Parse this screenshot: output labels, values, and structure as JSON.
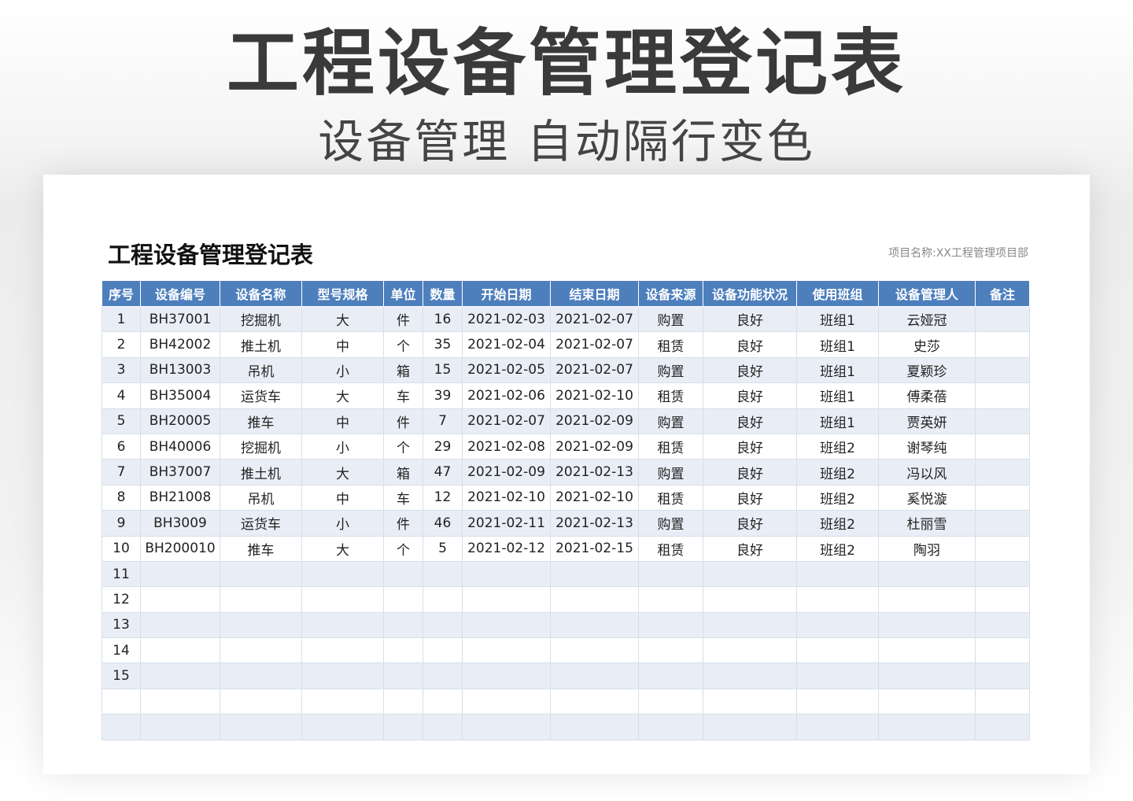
{
  "hero": {
    "title": "工程设备管理登记表",
    "subtitle": "设备管理 自动隔行变色"
  },
  "sheet": {
    "title": "工程设备管理登记表",
    "project_label": "项目名称:",
    "project_name": "XX工程管理项目部"
  },
  "table": {
    "headers": [
      "序号",
      "设备编号",
      "设备名称",
      "型号规格",
      "单位",
      "数量",
      "开始日期",
      "结束日期",
      "设备来源",
      "设备功能状况",
      "使用班组",
      "设备管理人",
      "备注"
    ],
    "rows": [
      [
        "1",
        "BH37001",
        "挖掘机",
        "大",
        "件",
        "16",
        "2021-02-03",
        "2021-02-07",
        "购置",
        "良好",
        "班组1",
        "云娅冠",
        ""
      ],
      [
        "2",
        "BH42002",
        "推土机",
        "中",
        "个",
        "35",
        "2021-02-04",
        "2021-02-07",
        "租赁",
        "良好",
        "班组1",
        "史莎",
        ""
      ],
      [
        "3",
        "BH13003",
        "吊机",
        "小",
        "箱",
        "15",
        "2021-02-05",
        "2021-02-07",
        "购置",
        "良好",
        "班组1",
        "夏颖珍",
        ""
      ],
      [
        "4",
        "BH35004",
        "运货车",
        "大",
        "车",
        "39",
        "2021-02-06",
        "2021-02-10",
        "租赁",
        "良好",
        "班组1",
        "傅柔蓓",
        ""
      ],
      [
        "5",
        "BH20005",
        "推车",
        "中",
        "件",
        "7",
        "2021-02-07",
        "2021-02-09",
        "购置",
        "良好",
        "班组1",
        "贾英妍",
        ""
      ],
      [
        "6",
        "BH40006",
        "挖掘机",
        "小",
        "个",
        "29",
        "2021-02-08",
        "2021-02-09",
        "租赁",
        "良好",
        "班组2",
        "谢琴纯",
        ""
      ],
      [
        "7",
        "BH37007",
        "推土机",
        "大",
        "箱",
        "47",
        "2021-02-09",
        "2021-02-13",
        "购置",
        "良好",
        "班组2",
        "冯以风",
        ""
      ],
      [
        "8",
        "BH21008",
        "吊机",
        "中",
        "车",
        "12",
        "2021-02-10",
        "2021-02-10",
        "租赁",
        "良好",
        "班组2",
        "奚悦漩",
        ""
      ],
      [
        "9",
        "BH3009",
        "运货车",
        "小",
        "件",
        "46",
        "2021-02-11",
        "2021-02-13",
        "购置",
        "良好",
        "班组2",
        "杜丽雪",
        ""
      ],
      [
        "10",
        "BH200010",
        "推车",
        "大",
        "个",
        "5",
        "2021-02-12",
        "2021-02-15",
        "租赁",
        "良好",
        "班组2",
        "陶羽",
        ""
      ],
      [
        "11",
        "",
        "",
        "",
        "",
        "",
        "",
        "",
        "",
        "",
        "",
        "",
        ""
      ],
      [
        "12",
        "",
        "",
        "",
        "",
        "",
        "",
        "",
        "",
        "",
        "",
        "",
        ""
      ],
      [
        "13",
        "",
        "",
        "",
        "",
        "",
        "",
        "",
        "",
        "",
        "",
        "",
        ""
      ],
      [
        "14",
        "",
        "",
        "",
        "",
        "",
        "",
        "",
        "",
        "",
        "",
        "",
        ""
      ],
      [
        "15",
        "",
        "",
        "",
        "",
        "",
        "",
        "",
        "",
        "",
        "",
        "",
        ""
      ],
      [
        "",
        "",
        "",
        "",
        "",
        "",
        "",
        "",
        "",
        "",
        "",
        "",
        ""
      ],
      [
        "",
        "",
        "",
        "",
        "",
        "",
        "",
        "",
        "",
        "",
        "",
        "",
        ""
      ]
    ]
  },
  "colors": {
    "header_bg": "#4e7fbd",
    "row_alt_bg": "#e9eef6",
    "row_bg": "#ffffff"
  }
}
